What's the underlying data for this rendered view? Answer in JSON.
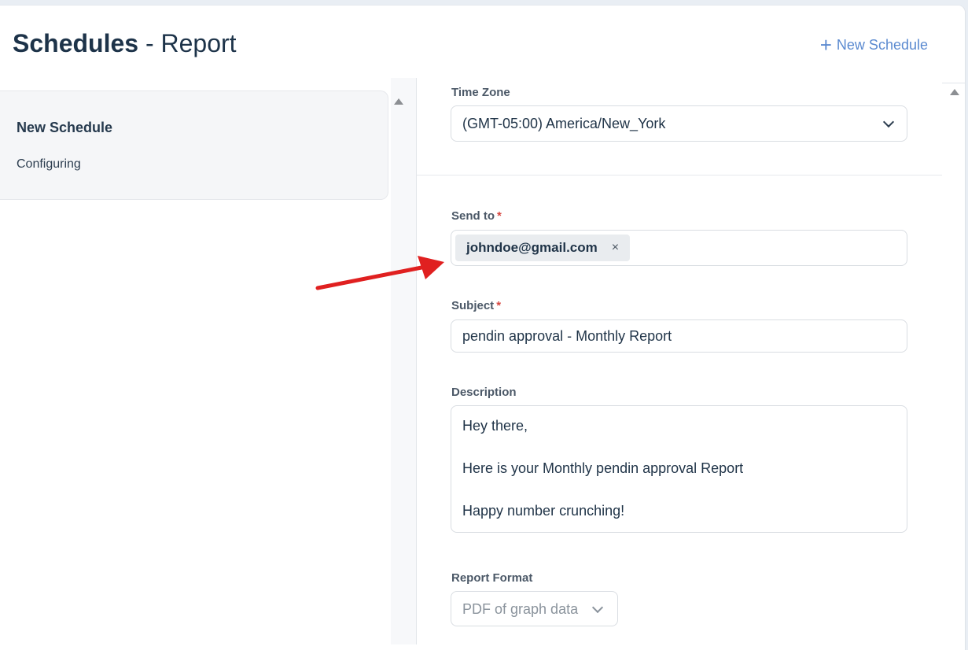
{
  "header": {
    "title_strong": "Schedules",
    "title_sep": "-",
    "title_light": "Report",
    "new_schedule_label": "New Schedule",
    "plus_icon": "+"
  },
  "sidebar": {
    "card_title": "New Schedule",
    "card_status": "Configuring"
  },
  "form": {
    "timezone": {
      "label": "Time Zone",
      "value": "(GMT-05:00) America/New_York"
    },
    "send_to": {
      "label": "Send to",
      "required_mark": "*",
      "recipients": [
        "johndoe@gmail.com"
      ],
      "remove_glyph": "×"
    },
    "subject": {
      "label": "Subject",
      "required_mark": "*",
      "value": "pendin approval - Monthly Report"
    },
    "description": {
      "label": "Description",
      "lines": [
        "Hey there,",
        "",
        "Here is your Monthly pendin approval Report",
        "",
        "Happy number crunching!"
      ]
    },
    "report_format": {
      "label": "Report Format",
      "value": "PDF of graph data"
    }
  },
  "colors": {
    "accent": "#5b8ad0",
    "required": "#d6463f",
    "annotation_arrow": "#e02020"
  }
}
